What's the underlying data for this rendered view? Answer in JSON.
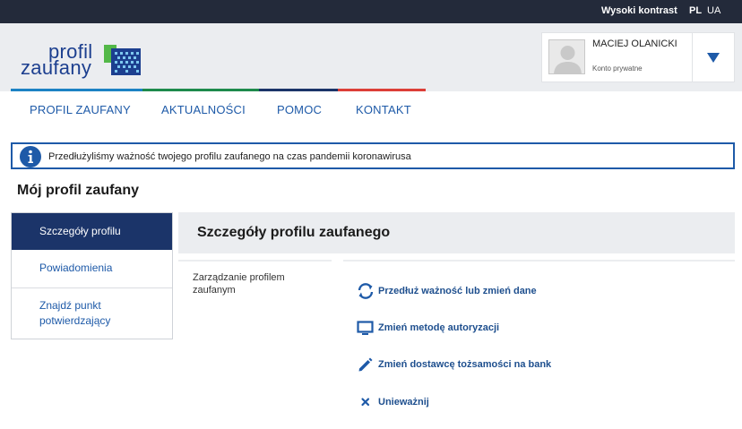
{
  "topbar": {
    "contrast_label": "Wysoki kontrast",
    "lang_pl": "PL",
    "lang_ua": "UA"
  },
  "logo": {
    "line1": "profil",
    "line2": "zaufany"
  },
  "user": {
    "name": "MACIEJ OLANICKI",
    "account_type": "Konto prywatne"
  },
  "colors": {
    "nav_bar": [
      "#1c82c4",
      "#1e8a4c",
      "#1b3469",
      "#dc3f38"
    ],
    "accent": "#1e5aa8",
    "active_sidebar": "#1b3469"
  },
  "nav": {
    "items": [
      "PROFIL ZAUFANY",
      "AKTUALNOŚCI",
      "POMOC",
      "KONTAKT"
    ]
  },
  "info": {
    "icon": "info-icon",
    "text": "Przedłużyliśmy ważność twojego profilu zaufanego na czas pandemii koronawirusa"
  },
  "page": {
    "title": "Mój profil zaufany"
  },
  "sidebar": {
    "items": [
      {
        "label": "Szczegóły profilu",
        "active": true
      },
      {
        "label": "Powiadomienia",
        "active": false
      },
      {
        "label": "Znajdź punkt potwierdzający",
        "active": false
      }
    ]
  },
  "content": {
    "title": "Szczegóły profilu zaufanego",
    "section_label": "Zarządzanie profilem zaufanym",
    "actions": [
      {
        "icon": "refresh-icon",
        "label": "Przedłuż ważność lub zmień dane"
      },
      {
        "icon": "monitor-icon",
        "label": "Zmień metodę autoryzacji"
      },
      {
        "icon": "pencil-icon",
        "label": "Zmień dostawcę tożsamości na bank"
      },
      {
        "icon": "close-icon",
        "label": "Unieważnij"
      }
    ]
  }
}
